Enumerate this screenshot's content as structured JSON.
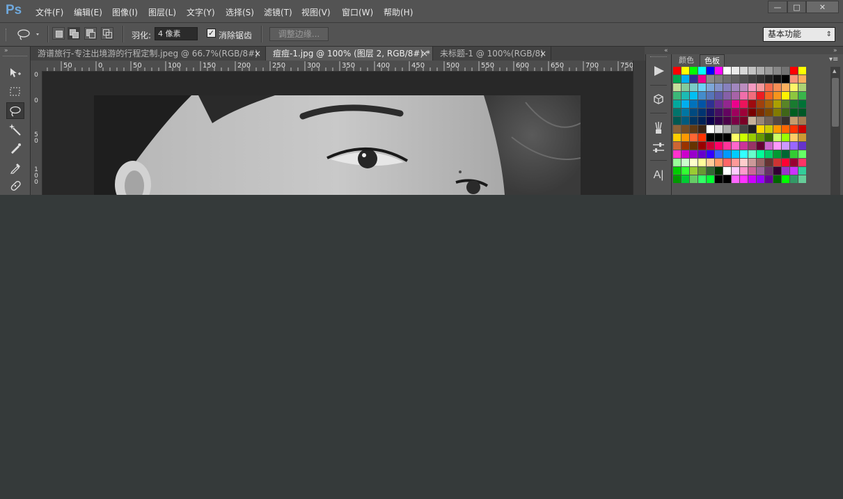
{
  "app": {
    "logo": "Ps"
  },
  "menu": [
    "文件(F)",
    "编辑(E)",
    "图像(I)",
    "图层(L)",
    "文字(Y)",
    "选择(S)",
    "滤镜(T)",
    "视图(V)",
    "窗口(W)",
    "帮助(H)"
  ],
  "window_controls": {
    "minimize": "—",
    "restore": "□",
    "close": "✕"
  },
  "options": {
    "feather_label": "羽化:",
    "feather_value": "4 像素",
    "anti_alias_label": "消除锯齿",
    "anti_alias_checked": true,
    "refine_edge_label": "调整边缘...",
    "workspace": "基本功能"
  },
  "tabs": [
    {
      "label": "游谱旅行-专注出境游的行程定制.jpeg @ 66.7%(RGB/8#)",
      "active": false,
      "close": "×"
    },
    {
      "label": "痘痘-1.jpg @ 100% (图层 2, RGB/8#) *",
      "active": true,
      "close": "×"
    },
    {
      "label": "未标题-1 @ 100%(RGB/8)",
      "active": false,
      "close": "×"
    }
  ],
  "ruler": {
    "h_labels": [
      "50",
      "0",
      "50",
      "100",
      "150",
      "200",
      "250",
      "300",
      "350",
      "400",
      "450",
      "500",
      "550",
      "600",
      "650",
      "700",
      "750"
    ],
    "v_labels": [
      "0",
      "0",
      "5\n0",
      "1\n0\n0"
    ]
  },
  "swatch_panel": {
    "tabs": [
      "颜色",
      "色板"
    ],
    "active_tab": "色板"
  },
  "icons": {
    "tools": [
      "move-icon",
      "marquee-icon",
      "lasso-icon",
      "magic-wand-icon",
      "brush-icon",
      "eyedropper-icon",
      "healing-icon"
    ],
    "strip": [
      "play-icon",
      "3d-icon",
      "brushes-icon",
      "adjust-icon",
      "character-icon"
    ]
  },
  "colors": {
    "swatch_rows": [
      [
        "#ff0000",
        "#ffff00",
        "#00ff00",
        "#00ffff",
        "#0000ff",
        "#ff00ff",
        "#ffffff",
        "#ebebeb",
        "#d7d7d7",
        "#c3c3c3",
        "#afafaf",
        "#9b9b9b",
        "#878787",
        "#737373",
        "#ff0000",
        "#ffff00"
      ],
      [
        "#00a651",
        "#00aeef",
        "#2e3192",
        "#ec008c",
        "#898989",
        "#7d7d7d",
        "#6e6e6e",
        "#5f5f5f",
        "#4f4f4f",
        "#3f3f3f",
        "#303030",
        "#212121",
        "#111111",
        "#000000",
        "#f7977a",
        "#fbaf5d"
      ],
      [
        "#c4df9b",
        "#82ca9c",
        "#7accc8",
        "#6dcff6",
        "#7da7d9",
        "#8393ca",
        "#8781bd",
        "#a187be",
        "#bc8dbf",
        "#f49ac1",
        "#f5989d",
        "#f26c4f",
        "#f68e55",
        "#fbaf5d",
        "#fff568",
        "#acd373"
      ],
      [
        "#3cb878",
        "#1cbbb4",
        "#00bff3",
        "#448ccb",
        "#5674b9",
        "#605ca8",
        "#8560a8",
        "#a763a8",
        "#f06eaa",
        "#f26d7d",
        "#ed1c24",
        "#f26522",
        "#f7941d",
        "#fff200",
        "#8dc63f",
        "#39b54a"
      ],
      [
        "#00a99d",
        "#00aeef",
        "#0072bc",
        "#0054a6",
        "#2e3192",
        "#662d91",
        "#92278f",
        "#ec008c",
        "#ed145b",
        "#9e0b0f",
        "#a0410d",
        "#a3620a",
        "#aba000",
        "#598527",
        "#197b30",
        "#007236"
      ],
      [
        "#00746b",
        "#0076a3",
        "#004a80",
        "#003471",
        "#1b1464",
        "#440e62",
        "#630460",
        "#9e005d",
        "#9e0039",
        "#790000",
        "#7b2e00",
        "#7d4900",
        "#827b00",
        "#406618",
        "#005e20",
        "#005826"
      ],
      [
        "#005952",
        "#005b7f",
        "#003663",
        "#002157",
        "#0d004c",
        "#32004b",
        "#4b0049",
        "#7b0046",
        "#7a0026",
        "#c7b299",
        "#998675",
        "#736357",
        "#534741",
        "#37302d",
        "#c69c6d",
        "#a67c52"
      ],
      [
        "#8c6239",
        "#754c24",
        "#603913",
        "#3c2415",
        "#ffffff",
        "#dddddd",
        "#aaaaaa",
        "#777777",
        "#444444",
        "#1f1f1f",
        "#ffd800",
        "#cccc00",
        "#ff9900",
        "#ff6600",
        "#ff3300",
        "#cc0000"
      ],
      [
        "#ffcc00",
        "#ff9900",
        "#ff6633",
        "#ff3300",
        "#000000",
        "#000000",
        "#000000",
        "#ffff66",
        "#ccff00",
        "#99cc00",
        "#669900",
        "#336600",
        "#ccff66",
        "#99ff00",
        "#ffcc66",
        "#cc9933"
      ],
      [
        "#cc6633",
        "#993300",
        "#663300",
        "#990000",
        "#cc0033",
        "#ff0066",
        "#ff3399",
        "#ff66cc",
        "#cc3399",
        "#993366",
        "#660033",
        "#cc66cc",
        "#ff99ff",
        "#cc99ff",
        "#9966ff",
        "#6633cc"
      ],
      [
        "#ff33cc",
        "#cc00cc",
        "#9900cc",
        "#6600cc",
        "#3300ff",
        "#3366ff",
        "#0099ff",
        "#00ccff",
        "#33ffff",
        "#66ffcc",
        "#00ff99",
        "#00cc66",
        "#009933",
        "#006633",
        "#33cc33",
        "#66ff66"
      ],
      [
        "#99ff99",
        "#ccffcc",
        "#ffffcc",
        "#ffff99",
        "#ffcc99",
        "#ff9966",
        "#ff6666",
        "#ff9999",
        "#ffcccc",
        "#cc9999",
        "#996666",
        "#663333",
        "#cc3333",
        "#ff0033",
        "#990033",
        "#ff3366"
      ],
      [
        "#00cc00",
        "#33ff33",
        "#99cc33",
        "#669933",
        "#336633",
        "#003300",
        "#ffffff",
        "#ffccff",
        "#ff99cc",
        "#cc6699",
        "#996699",
        "#663366",
        "#330033",
        "#9933cc",
        "#cc33ff",
        "#33cc99"
      ],
      [
        "#009900",
        "#00cc33",
        "#66cc66",
        "#33ff66",
        "#00ff33",
        "#000000",
        "#000000",
        "#ff66ff",
        "#ff33ff",
        "#cc00ff",
        "#9900ff",
        "#660099",
        "#006600",
        "#00ff00",
        "#339966",
        "#66cc99"
      ]
    ]
  }
}
